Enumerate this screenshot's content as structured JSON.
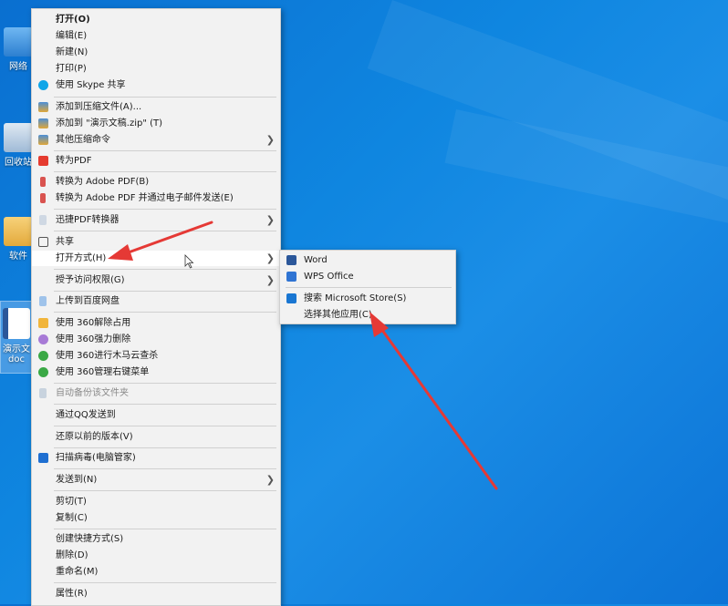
{
  "desktop": {
    "icons": [
      {
        "label": "网络"
      },
      {
        "label": "回收站"
      },
      {
        "label": "软件"
      },
      {
        "label": "演示文",
        "label2": "doc"
      }
    ]
  },
  "context_menu": {
    "items": [
      {
        "label": "打开(O)"
      },
      {
        "label": "编辑(E)"
      },
      {
        "label": "新建(N)"
      },
      {
        "label": "打印(P)"
      },
      {
        "label": "使用 Skype 共享",
        "icon": "skype-icon"
      },
      {
        "label": "添加到压缩文件(A)...",
        "icon": "archive-icon"
      },
      {
        "label": "添加到 \"演示文稿.zip\" (T)",
        "icon": "archive-icon"
      },
      {
        "label": "其他压缩命令",
        "icon": "archive-icon"
      },
      {
        "label": "转为PDF",
        "icon": "pdf-icon"
      },
      {
        "label": "转换为 Adobe PDF(B)",
        "icon": "adobe-pdf-icon"
      },
      {
        "label": "转换为 Adobe PDF 并通过电子邮件发送(E)",
        "icon": "adobe-pdf-icon"
      },
      {
        "label": "迅捷PDF转换器",
        "icon": "pdf-converter-icon"
      },
      {
        "label": "共享",
        "icon": "share-icon"
      },
      {
        "label": "打开方式(H)"
      },
      {
        "label": "授予访问权限(G)"
      },
      {
        "label": "上传到百度网盘",
        "icon": "baidu-cloud-icon"
      },
      {
        "label": "使用 360解除占用",
        "icon": "360-unlock-icon"
      },
      {
        "label": "使用 360强力删除",
        "icon": "360-delete-icon"
      },
      {
        "label": "使用 360进行木马云查杀",
        "icon": "360-scan-icon"
      },
      {
        "label": "使用 360管理右键菜单",
        "icon": "360-manage-icon"
      },
      {
        "label": "自动备份该文件夹",
        "icon": "backup-icon"
      },
      {
        "label": "通过QQ发送到"
      },
      {
        "label": "还原以前的版本(V)"
      },
      {
        "label": "扫描病毒(电脑管家)",
        "icon": "shield-icon"
      },
      {
        "label": "发送到(N)"
      },
      {
        "label": "剪切(T)"
      },
      {
        "label": "复制(C)"
      },
      {
        "label": "创建快捷方式(S)"
      },
      {
        "label": "删除(D)"
      },
      {
        "label": "重命名(M)"
      },
      {
        "label": "属性(R)"
      }
    ]
  },
  "open_with_menu": {
    "items": [
      {
        "label": "Word",
        "icon": "word-icon"
      },
      {
        "label": "WPS Office",
        "icon": "wps-icon"
      },
      {
        "label": "搜索 Microsoft Store(S)",
        "icon": "store-icon"
      },
      {
        "label": "选择其他应用(C)"
      }
    ]
  },
  "colors": {
    "desktop_blue": "#0f86e0",
    "annotation_red": "#e53935",
    "word_blue": "#2b579a"
  }
}
